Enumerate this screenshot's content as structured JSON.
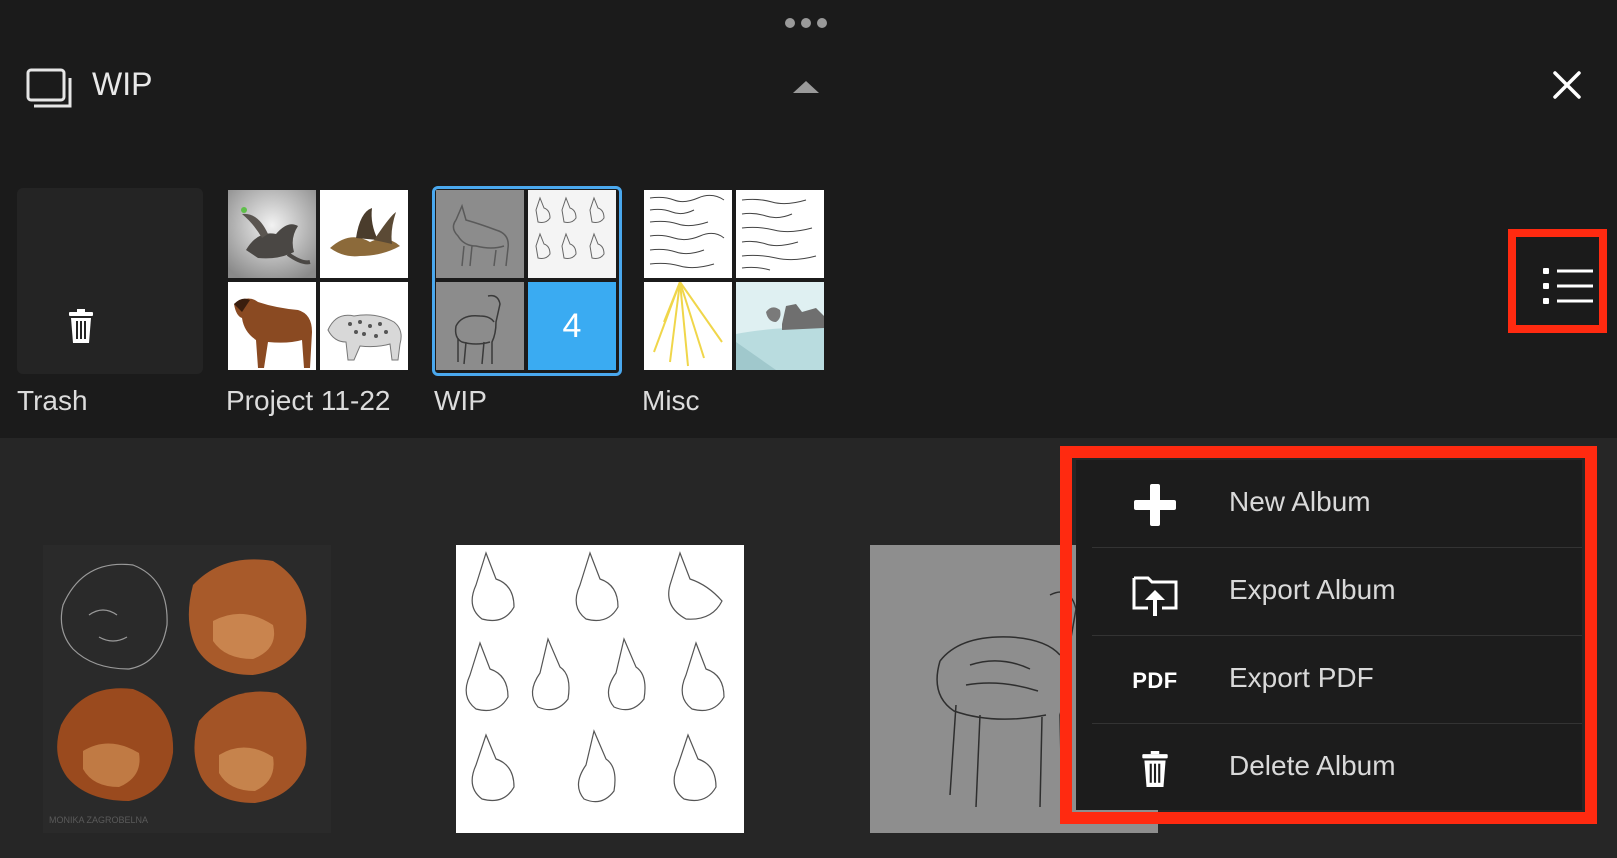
{
  "header": {
    "title": "WIP"
  },
  "albums": [
    {
      "name": "Trash"
    },
    {
      "name": "Project 11-22"
    },
    {
      "name": "WIP",
      "count": "4"
    },
    {
      "name": "Misc"
    }
  ],
  "menu": {
    "items": [
      {
        "label": "New Album",
        "icon": "plus-icon"
      },
      {
        "label": "Export Album",
        "icon": "folder-export-icon"
      },
      {
        "label": "Export PDF",
        "icon": "pdf-icon",
        "icon_text": "PDF"
      },
      {
        "label": "Delete Album",
        "icon": "trash-icon"
      }
    ]
  },
  "photos_bottom": [
    {
      "watermark": "MONIKA ZAGROBELNA"
    },
    {},
    {}
  ],
  "colors": {
    "highlight": "#ff2a10",
    "selection": "#4aa8ee",
    "count_tile": "#3aabf2",
    "panel_top": "#1b1b1b",
    "panel_bottom": "#262626"
  }
}
